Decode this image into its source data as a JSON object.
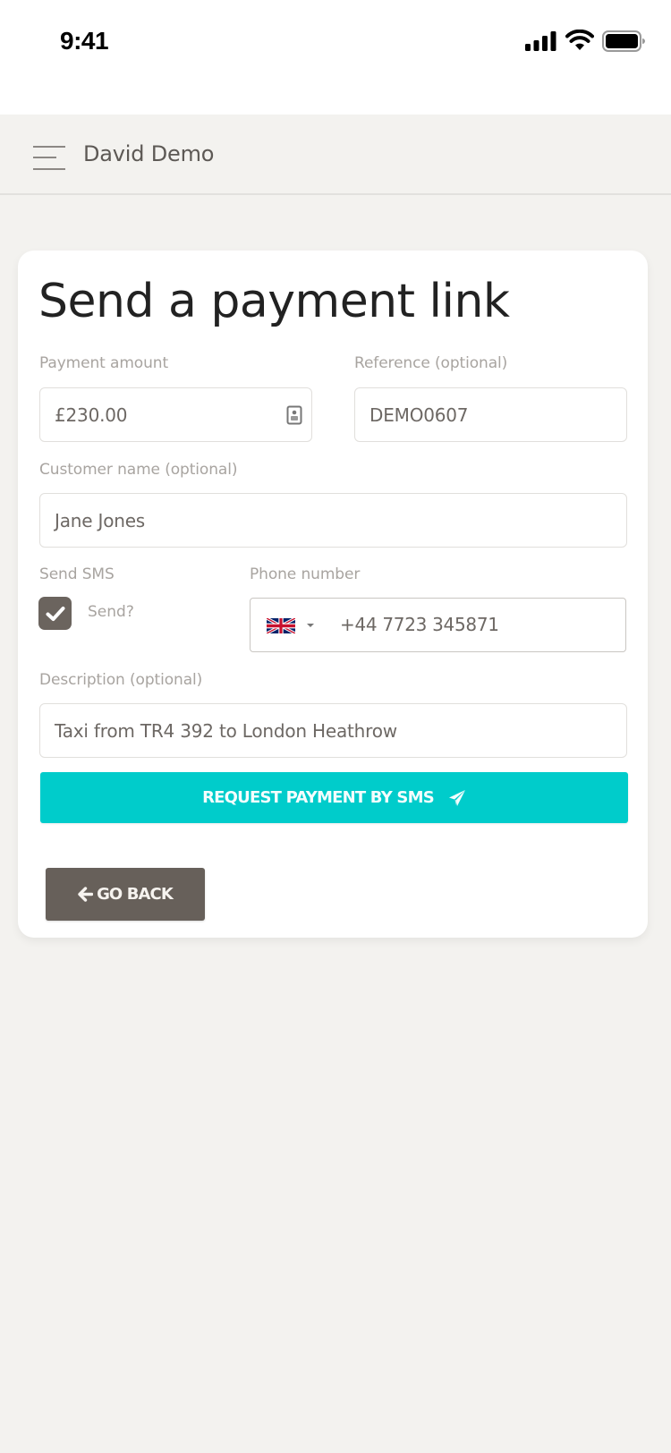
{
  "status_bar": {
    "time": "9:41",
    "icons": [
      "cellular-signal-icon",
      "wifi-icon",
      "battery-icon"
    ]
  },
  "header": {
    "menu_icon": "hamburger-menu-icon",
    "user_name": "David Demo"
  },
  "form": {
    "title": "Send a payment link",
    "payment_amount": {
      "label": "Payment amount",
      "value": "£230.00",
      "icon": "autofill-contact-icon"
    },
    "reference": {
      "label": "Reference (optional)",
      "value": "DEMO0607"
    },
    "customer_name": {
      "label": "Customer name (optional)",
      "value": "Jane Jones"
    },
    "send_sms": {
      "label": "Send SMS",
      "checkbox_label": "Send?",
      "checked": true
    },
    "phone_number": {
      "label": "Phone number",
      "country_flag": "uk-flag-icon",
      "value": "+44 7723 345871"
    },
    "description": {
      "label": "Description (optional)",
      "value": "Taxi from TR4 392 to London Heathrow"
    },
    "submit_button": {
      "label": "REQUEST PAYMENT BY SMS",
      "icon": "paper-plane-icon"
    },
    "back_button": {
      "label": "GO BACK",
      "icon": "arrow-left-icon"
    }
  },
  "colors": {
    "accent": "#00cccb",
    "back_button": "#67605a",
    "page_background": "#f3f2ef",
    "card_background": "#ffffff"
  }
}
